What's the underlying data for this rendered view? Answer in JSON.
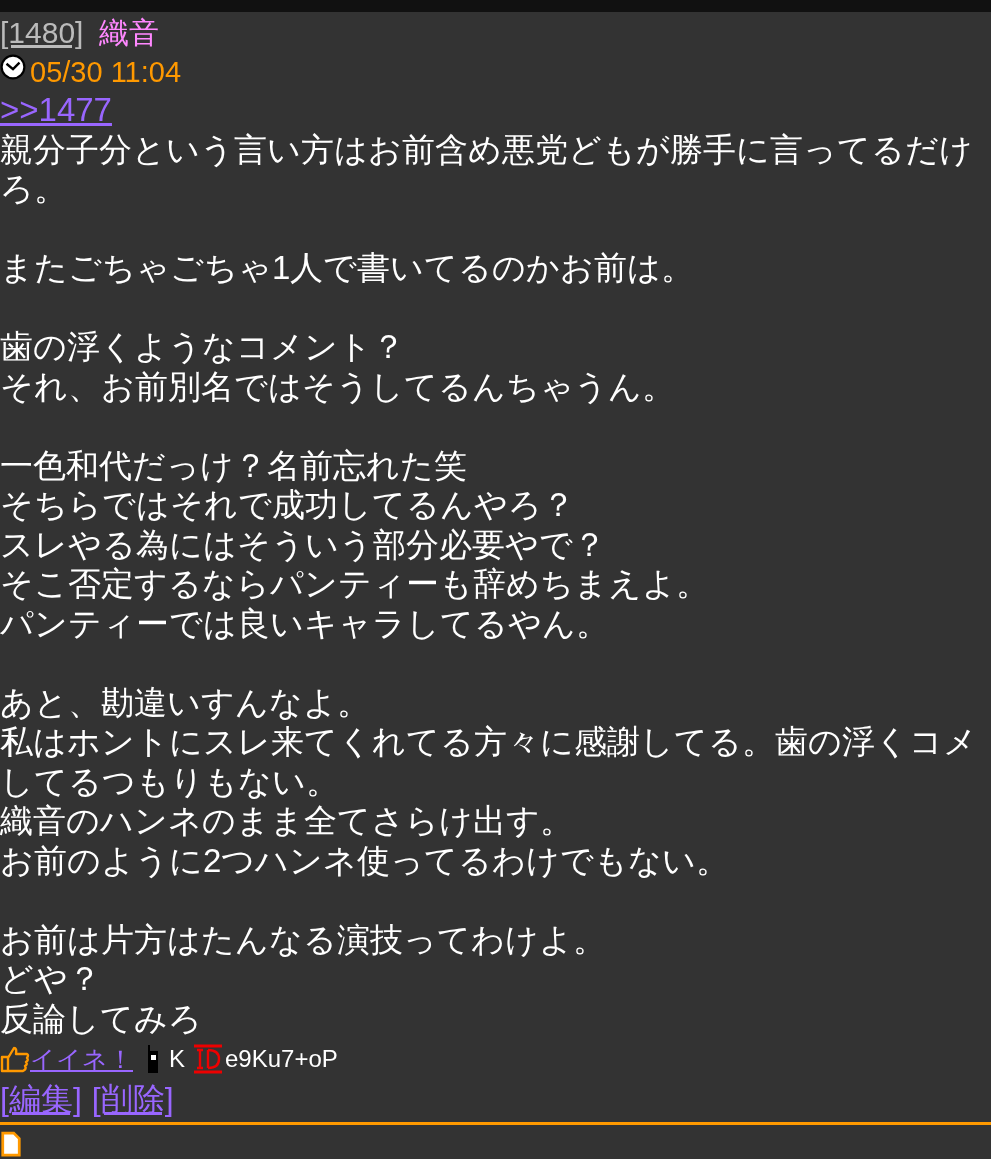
{
  "post": {
    "number": "[1480]",
    "name": "織音",
    "date": "05/30 11:04",
    "reply_link": ">>1477",
    "paragraphs": [
      [
        "親分子分という言い方はお前含め悪党どもが勝手に言ってるだけ",
        "ろ。"
      ],
      [
        "またごちゃごちゃ1人で書いてるのかお前は。"
      ],
      [
        "歯の浮くようなコメント？",
        "それ、お前別名ではそうしてるんちゃうん。"
      ],
      [
        "一色和代だっけ？名前忘れた笑",
        "そちらではそれで成功してるんやろ？",
        "スレやる為にはそういう部分必要やで？",
        "そこ否定するならパンティーも辞めちまえよ。",
        "パンティーでは良いキャラしてるやん。"
      ],
      [
        "あと、勘違いすんなよ。",
        "私はホントにスレ来てくれてる方々に感謝してる。歯の浮くコメ",
        "してるつもりもない。",
        "織音のハンネのまま全てさらけ出す。",
        "お前のように2つハンネ使ってるわけでもない。"
      ],
      [
        "お前は片方はたんなる演技ってわけよ。",
        "どや？",
        "反論してみろ"
      ]
    ],
    "like_link": "イイネ！",
    "carrier": "K",
    "id": "e9Ku7+oP",
    "actions": [
      "[編集]",
      "[削除]"
    ]
  }
}
